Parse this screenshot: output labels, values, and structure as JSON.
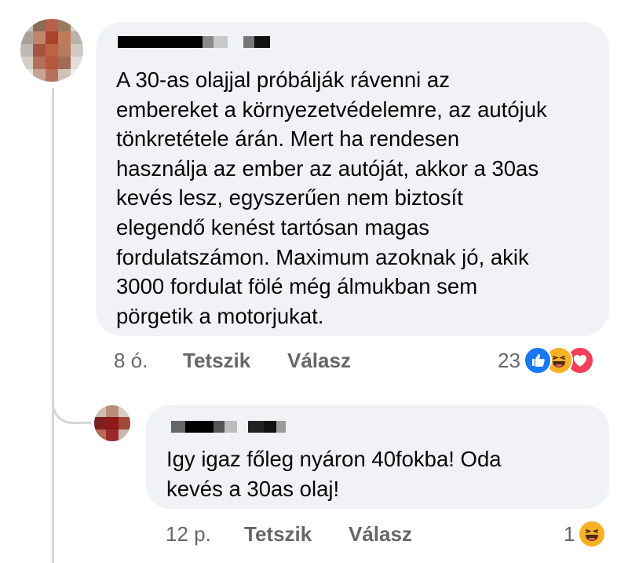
{
  "main_comment": {
    "author_redacted": true,
    "text": "A 30-as olajjal próbálják rávenni az\nembereket a környezetvédelemre, az autójuk\ntönkretétele árán. Mert ha rendesen\nhasználja az ember az autóját, akkor a 30as\nkevés lesz, egyszerűen nem biztosít\nelegendő kenést tartósan magas\nfordulatszámon. Maximum azoknak jó, akik\n3000 fordulat fölé még álmukban sem\npörgetik a motorjukat.",
    "time": "8 ó.",
    "like_label": "Tetszik",
    "reply_label": "Válasz",
    "reaction_count": "23",
    "reactions": [
      "like-icon",
      "haha-icon",
      "love-icon"
    ]
  },
  "reply_comment": {
    "author_redacted": true,
    "text": "Igy igaz főleg nyáron 40fokba! Oda\nkevés a 30as olaj!",
    "time": "12 p.",
    "like_label": "Tetszik",
    "reply_label": "Válasz",
    "reaction_count": "1",
    "reactions": [
      "haha-icon"
    ]
  },
  "colors": {
    "bubble": "#f0f2f5",
    "meta_text": "#65676b",
    "like_blue": "#1877f2",
    "haha_yellow": "#f7b125",
    "love_red": "#f33e58"
  }
}
